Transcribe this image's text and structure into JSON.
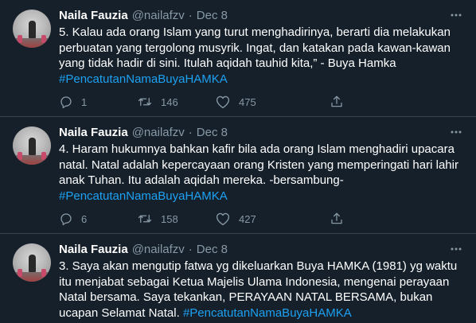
{
  "tweets": [
    {
      "name": "Naila Fauzia",
      "handle": "@nailafzv",
      "separator": "·",
      "date": "Dec 8",
      "text": "5. Kalau ada orang Islam yang turut menghadirinya, berarti dia melakukan perbuatan yang tergolong musyrik. Ingat, dan katakan pada kawan-kawan yang tidak hadir di sini. Itulah aqidah tauhid kita,” - Buya Hamka ",
      "hashtag": "#PencatutanNamaBuyaHAMKA",
      "replies": "1",
      "retweets": "146",
      "likes": "475"
    },
    {
      "name": "Naila Fauzia",
      "handle": "@nailafzv",
      "separator": "·",
      "date": "Dec 8",
      "text": "4. Haram hukumnya bahkan kafir bila ada orang Islam menghadiri upacara natal. Natal adalah kepercayaan orang Kristen yang memperingati hari lahir anak Tuhan. Itu adalah aqidah mereka. -bersambung- ",
      "hashtag": "#PencatutanNamaBuyaHAMKA",
      "replies": "6",
      "retweets": "158",
      "likes": "427"
    },
    {
      "name": "Naila Fauzia",
      "handle": "@nailafzv",
      "separator": "·",
      "date": "Dec 8",
      "text": "3. Saya akan mengutip fatwa yg dikeluarkan Buya HAMKA (1981) yg waktu itu menjabat sebagai Ketua Majelis Ulama Indonesia, mengenai perayaan Natal bersama. Saya tekankan, PERAYAAN NATAL BERSAMA, bukan ucapan Selamat Natal. ",
      "hashtag": "#PencatutanNamaBuyaHAMKA"
    }
  ],
  "colors": {
    "background": "#15202b",
    "text": "#ffffff",
    "secondary": "#8899a6",
    "link": "#1da1f2",
    "divider": "#38444d"
  },
  "icons": [
    "more-icon",
    "reply-icon",
    "retweet-icon",
    "like-icon",
    "share-icon"
  ]
}
